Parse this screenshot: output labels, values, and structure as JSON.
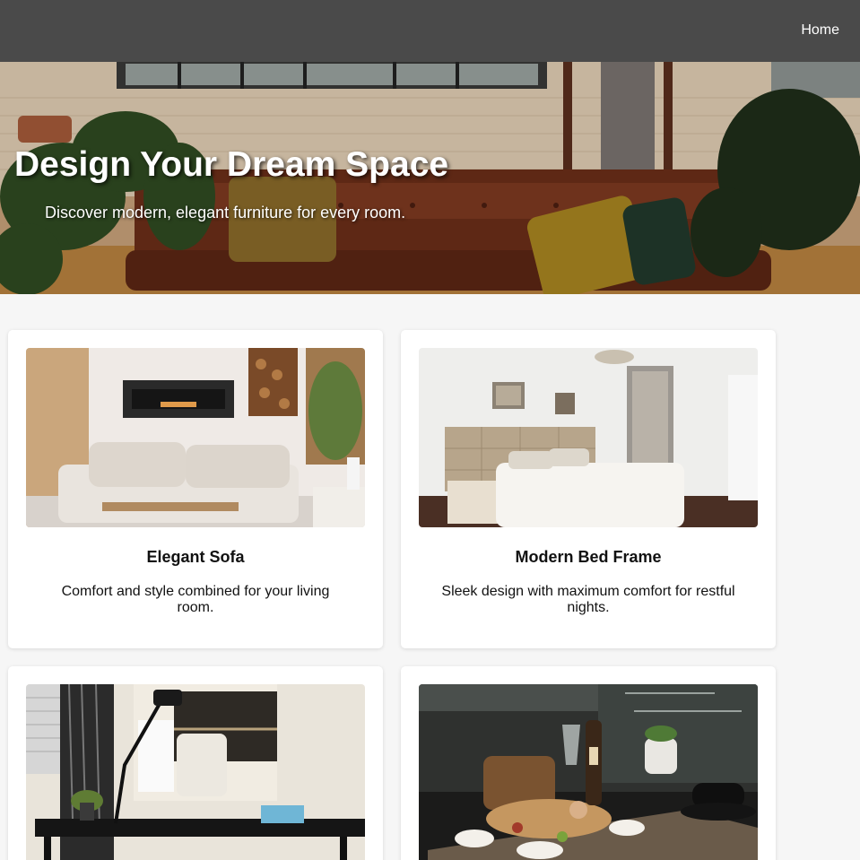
{
  "nav": {
    "home_label": "Home"
  },
  "hero": {
    "title": "Design Your Dream Space",
    "subtitle": "Discover modern, elegant furniture for every room."
  },
  "products": [
    {
      "title": "Elegant Sofa",
      "description": "Comfort and style combined for your living room.",
      "image": "living-room-photo"
    },
    {
      "title": "Modern Bed Frame",
      "description": "Sleek design with maximum comfort for restful nights.",
      "image": "bedroom-photo"
    },
    {
      "title": "",
      "description": "",
      "image": "home-office-desk-photo"
    },
    {
      "title": "",
      "description": "",
      "image": "dining-table-photo"
    }
  ],
  "colors": {
    "topbar": "#4a4a4a",
    "page_bg": "#f6f6f6",
    "card_bg": "#ffffff",
    "hero_text": "#ffffff"
  }
}
